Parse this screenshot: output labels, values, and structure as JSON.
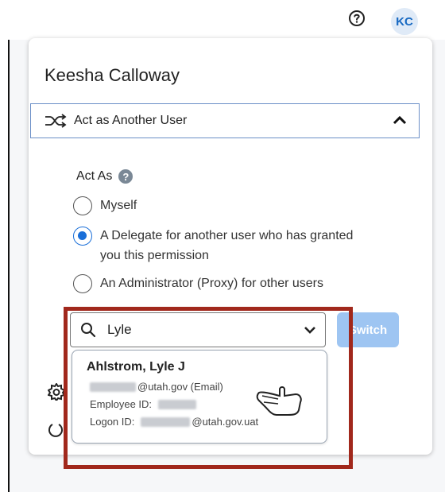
{
  "header": {
    "avatar_initials": "KC",
    "help_icon": "question-circle-icon"
  },
  "panel": {
    "user_name": "Keesha Calloway",
    "section_label": "Act as Another User",
    "act_as_label": "Act As",
    "options": [
      {
        "label": "Myself",
        "checked": false
      },
      {
        "label_line1": "A Delegate for another user who has granted",
        "label_line2": "you this permission",
        "checked": true
      },
      {
        "label": "An Administrator (Proxy) for other users",
        "checked": false
      }
    ],
    "search": {
      "value": "Lyle"
    },
    "switch_label": "Switch",
    "result": {
      "name": "Ahlstrom, Lyle J",
      "email_suffix": "@utah.gov (Email)",
      "employee_id_label": "Employee ID:",
      "logon_id_label": "Logon ID:",
      "logon_suffix": "@utah.gov.uat"
    }
  },
  "colors": {
    "accent": "#1a6fd8",
    "highlight": "#a1281c",
    "switch_disabled": "#9ec5f2"
  }
}
